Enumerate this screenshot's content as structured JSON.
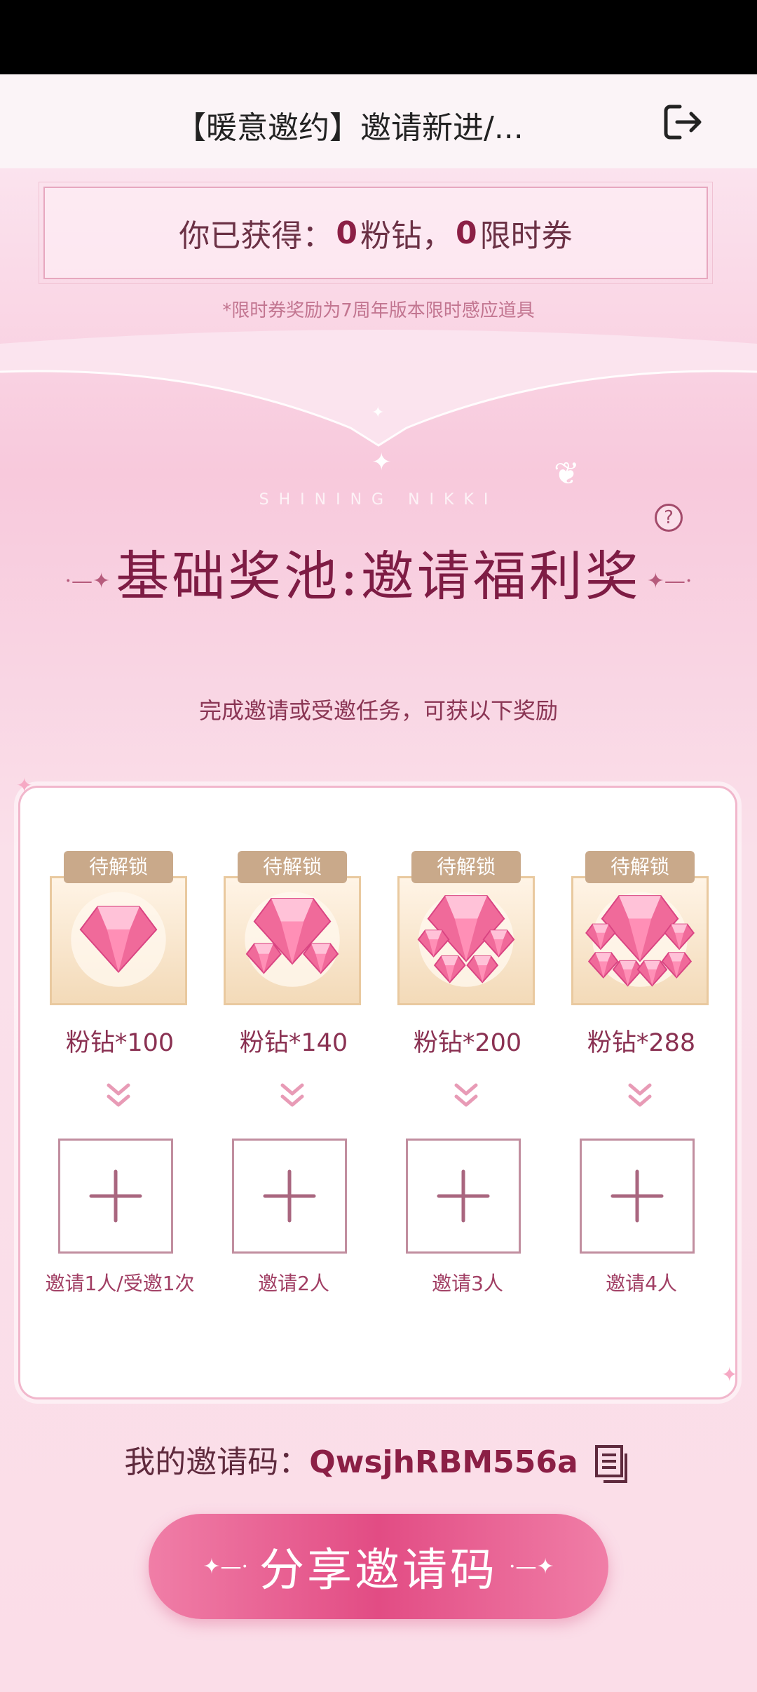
{
  "app": {
    "title": "【暖意邀约】邀请新进/..."
  },
  "summary": {
    "prefix": "你已获得：",
    "diamonds_value": "0",
    "diamonds_label": "粉钻，",
    "vouchers_value": "0",
    "vouchers_label": "限时券",
    "note": "*限时券奖励为7周年版本限时感应道具"
  },
  "pool": {
    "brand": "SHINING NIKKI",
    "title": "基础奖池:邀请福利奖",
    "subtitle": "完成邀请或受邀任务，可获以下奖励",
    "help_symbol": "?"
  },
  "rewards": [
    {
      "lock_label": "待解锁",
      "amount": "粉钻*100",
      "condition": "邀请1人/受邀1次",
      "gems": 1
    },
    {
      "lock_label": "待解锁",
      "amount": "粉钻*140",
      "condition": "邀请2人",
      "gems": 3
    },
    {
      "lock_label": "待解锁",
      "amount": "粉钻*200",
      "condition": "邀请3人",
      "gems": 5
    },
    {
      "lock_label": "待解锁",
      "amount": "粉钻*288",
      "condition": "邀请4人",
      "gems": 7
    }
  ],
  "invite": {
    "label": "我的邀请码：",
    "code": "QwsjhRBM556a"
  },
  "share_button": {
    "label": "分享邀请码"
  },
  "colors": {
    "accent": "#e24c84",
    "title_text": "#7e1c44",
    "card_border": "#e9c99f"
  }
}
